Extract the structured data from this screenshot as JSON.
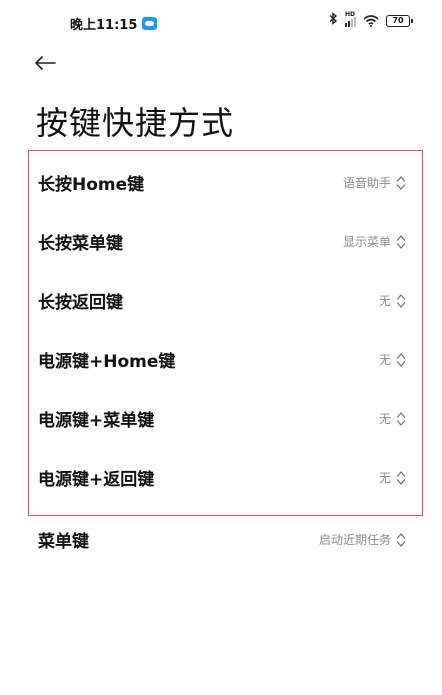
{
  "status_bar": {
    "time": "晚上11:15",
    "signal_hd": "HD",
    "battery": "70"
  },
  "header": {
    "title": "按键快捷方式"
  },
  "settings": [
    {
      "label": "长按Home键",
      "value": "语音助手"
    },
    {
      "label": "长按菜单键",
      "value": "显示菜单"
    },
    {
      "label": "长按返回键",
      "value": "无"
    },
    {
      "label": "电源键+Home键",
      "value": "无"
    },
    {
      "label": "电源键+菜单键",
      "value": "无"
    },
    {
      "label": "电源键+返回键",
      "value": "无"
    },
    {
      "label": "菜单键",
      "value": "启动近期任务"
    }
  ],
  "colors": {
    "highlight_border": "#e05252",
    "value_text": "#8c8c8c"
  },
  "icons": {
    "back": "arrow-left-icon",
    "picker": "up-down-chevron-icon"
  }
}
